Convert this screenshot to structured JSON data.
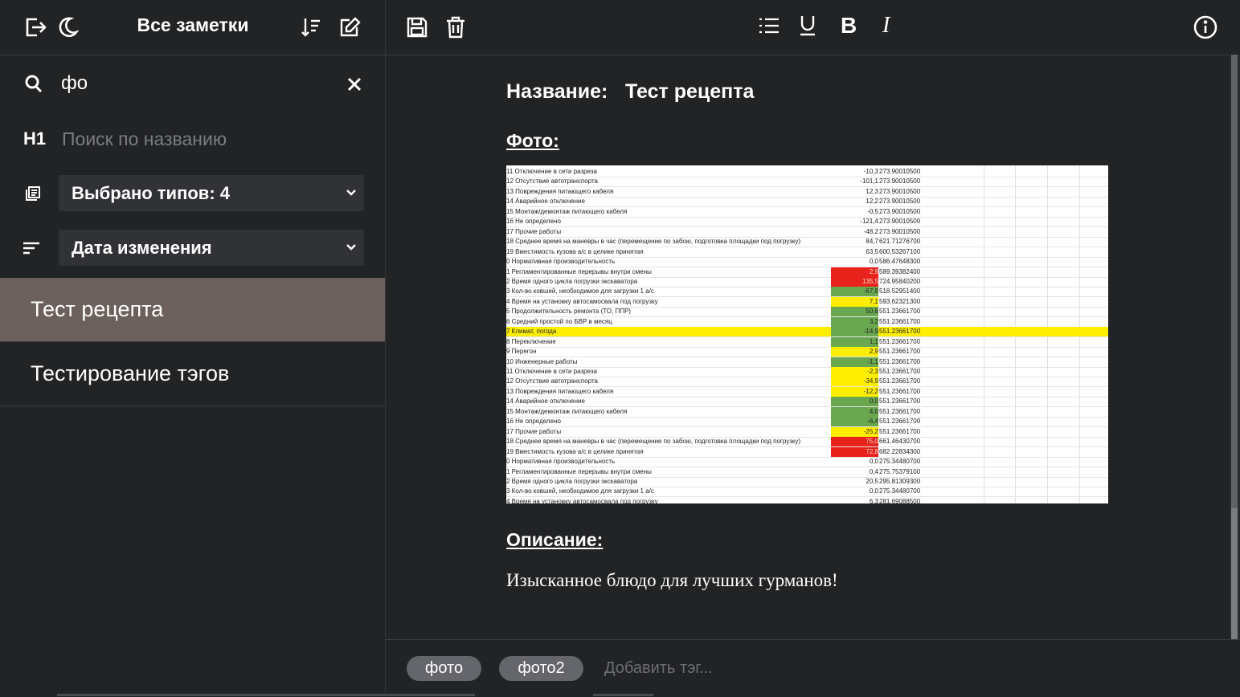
{
  "sidebar": {
    "title": "Все заметки",
    "search": {
      "value": "фо"
    },
    "name_filter": {
      "label": "H1",
      "placeholder": "Поиск по названию"
    },
    "types_select": {
      "value": "Выбрано типов: 4"
    },
    "sort_select": {
      "value": "Дата изменения"
    },
    "notes": [
      {
        "title": "Тест рецепта",
        "selected": true
      },
      {
        "title": "Тестирование тэгов",
        "selected": false
      }
    ]
  },
  "toolbar": {
    "icons": [
      "save-icon",
      "delete-icon",
      "bulleted-list-icon",
      "underline-icon",
      "bold-icon",
      "italic-icon",
      "info-icon"
    ],
    "bold_label": "B",
    "italic_label": "I"
  },
  "note": {
    "name_label": "Название:",
    "name_value": "Тест рецепта",
    "photo_label": "Фото:",
    "description_label": "Описание:",
    "description_text": "Изысканное блюдо для лучших гурманов!",
    "photo_sheet_rows": [
      {
        "n": "11",
        "text": "Отключение в сети разреза",
        "value": "-10,3",
        "calc": "273.90010500",
        "color": ""
      },
      {
        "n": "12",
        "text": "Отсутствие автотранспорта",
        "value": "-101,1",
        "calc": "273.90010500",
        "color": ""
      },
      {
        "n": "13",
        "text": "Повреждения питающего кабеля",
        "value": "12,3",
        "calc": "273.90010500",
        "color": ""
      },
      {
        "n": "14",
        "text": "Аварийное отключение",
        "value": "12,2",
        "calc": "273.90010500",
        "color": ""
      },
      {
        "n": "15",
        "text": "Монтаж/демонтаж питающего кабеля",
        "value": "-0,5",
        "calc": "273.90010500",
        "color": ""
      },
      {
        "n": "16",
        "text": "Не определено",
        "value": "-121,4",
        "calc": "273.90010500",
        "color": ""
      },
      {
        "n": "17",
        "text": "Прочие работы",
        "value": "-48,2",
        "calc": "273.90010500",
        "color": ""
      },
      {
        "n": "18",
        "text": "Среднее время на маневры в час (перемещение по забою, подготовка площадки под погрузку)",
        "value": "84,7",
        "calc": "621.71276700",
        "color": ""
      },
      {
        "n": "19",
        "text": "Вместимость кузова а/с в целике принятая",
        "value": "63,5",
        "calc": "600.53267100",
        "color": ""
      },
      {
        "n": "0",
        "text": "Нормативная производительность",
        "value": "0,0",
        "calc": "586.47648300",
        "color": ""
      },
      {
        "n": "1",
        "text": "Регламентированные перерывы внутри смены",
        "value": "2,9",
        "calc": "589.39382400",
        "color": "#e8231c"
      },
      {
        "n": "2",
        "text": "Время одного цикла погрузки экскаватора",
        "value": "135,5",
        "calc": "724.95840200",
        "color": "#e8231c"
      },
      {
        "n": "3",
        "text": "Кол-во ковшей, необходимое для загрузки 1 а/с",
        "value": "-67,9",
        "calc": "518.52951400",
        "color": "#6aa84f"
      },
      {
        "n": "4",
        "text": "Время на установку автосамосвала под погрузку",
        "value": "7,1",
        "calc": "593.62321300",
        "color": "#ffee00"
      },
      {
        "n": "5",
        "text": "Продолжительность ремонта (ТО, ППР)",
        "value": "50,6",
        "calc": "551.23661700",
        "color": "#6aa84f"
      },
      {
        "n": "6",
        "text": "Средний простой по БВР в месяц",
        "value": "3,2",
        "calc": "551.23661700",
        "color": "#6aa84f"
      },
      {
        "n": "7",
        "text": "Климат, погода",
        "value": "-14,9",
        "calc": "551.23661700",
        "color": "#6aa84f",
        "highlight": true
      },
      {
        "n": "8",
        "text": "Переключение",
        "value": "1,1",
        "calc": "551.23661700",
        "color": "#6aa84f"
      },
      {
        "n": "9",
        "text": "Перегон",
        "value": "2,9",
        "calc": "551.23661700",
        "color": "#ffee00"
      },
      {
        "n": "10",
        "text": "Инженерные работы",
        "value": "-1,1",
        "calc": "551.23661700",
        "color": "#6aa84f"
      },
      {
        "n": "11",
        "text": "Отключение в сети разреза",
        "value": "-2,3",
        "calc": "551.23661700",
        "color": "#ffee00"
      },
      {
        "n": "12",
        "text": "Отсутствие автотранспорта",
        "value": "-34,9",
        "calc": "551.23661700",
        "color": "#ffee00"
      },
      {
        "n": "13",
        "text": "Повреждения питающего кабеля",
        "value": "-12,2",
        "calc": "551.23661700",
        "color": "#ffee00"
      },
      {
        "n": "14",
        "text": "Аварийное отключение",
        "value": "0,0",
        "calc": "551.23661700",
        "color": "#6aa84f"
      },
      {
        "n": "15",
        "text": "Монтаж/демонтаж питающего кабеля",
        "value": "4,0",
        "calc": "551.23661700",
        "color": "#6aa84f"
      },
      {
        "n": "16",
        "text": "Не определено",
        "value": "-6,4",
        "calc": "551.23661700",
        "color": "#6aa84f"
      },
      {
        "n": "17",
        "text": "Прочие работы",
        "value": "-25,2",
        "calc": "551.23661700",
        "color": "#ffee00"
      },
      {
        "n": "18",
        "text": "Среднее время на маневры в час (перемещение по забою, подготовка площадки под погрузку)",
        "value": "75,0",
        "calc": "661.46430700",
        "color": "#e8231c"
      },
      {
        "n": "19",
        "text": "Вместимость кузова а/с в целике принятая",
        "value": "72,8",
        "calc": "682.22834300",
        "color": "#e8231c"
      },
      {
        "n": "0",
        "text": "Нормативная производительность",
        "value": "0,0",
        "calc": "275.34480700",
        "color": ""
      },
      {
        "n": "1",
        "text": "Регламентированные перерывы внутри смены",
        "value": "0,4",
        "calc": "275.75379100",
        "color": ""
      },
      {
        "n": "2",
        "text": "Время одного цикла погрузки экскаватора",
        "value": "20,5",
        "calc": "295.81309300",
        "color": ""
      },
      {
        "n": "3",
        "text": "Кол-во ковшей, необходимое для загрузки 1 а/с",
        "value": "0,0",
        "calc": "275.34480700",
        "color": ""
      },
      {
        "n": "4",
        "text": "Время на установку автосамосвала под погрузку",
        "value": "6,3",
        "calc": "281.69088500",
        "color": ""
      }
    ]
  },
  "tags": {
    "items": [
      "фото",
      "фото2"
    ],
    "placeholder": "Добавить тэг..."
  }
}
